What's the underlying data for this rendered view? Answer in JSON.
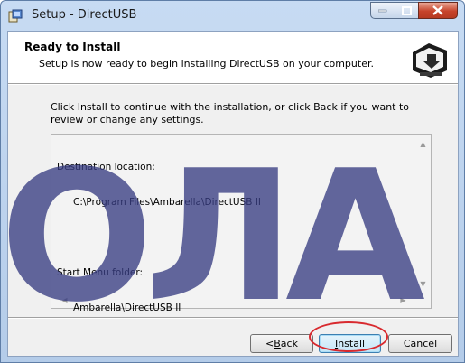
{
  "window": {
    "title": "Setup - DirectUSB"
  },
  "header": {
    "heading": "Ready to Install",
    "subheading": "Setup is now ready to begin installing DirectUSB on your computer."
  },
  "body": {
    "instruction": "Click Install to continue with the installation, or click Back if you want to review or change any settings."
  },
  "memo": {
    "lines": [
      "Destination location:",
      "C:\\Program Files\\Ambarella\\DirectUSB II",
      "",
      "Start Menu folder:",
      "Ambarella\\DirectUSB II"
    ]
  },
  "buttons": {
    "back_prefix": "< ",
    "back_key": "B",
    "back_rest": "ack",
    "install_key": "I",
    "install_rest": "nstall",
    "cancel": "Cancel"
  },
  "overlay": {
    "text": "ОЛА"
  },
  "colors": {
    "titlebar": "#c7dbf3",
    "close_button": "#c7442b",
    "highlight_ring": "#d8292e",
    "overlay": "#373c82"
  },
  "icons": {
    "app": "setup-app-icon",
    "wizard": "computer-install-icon"
  }
}
